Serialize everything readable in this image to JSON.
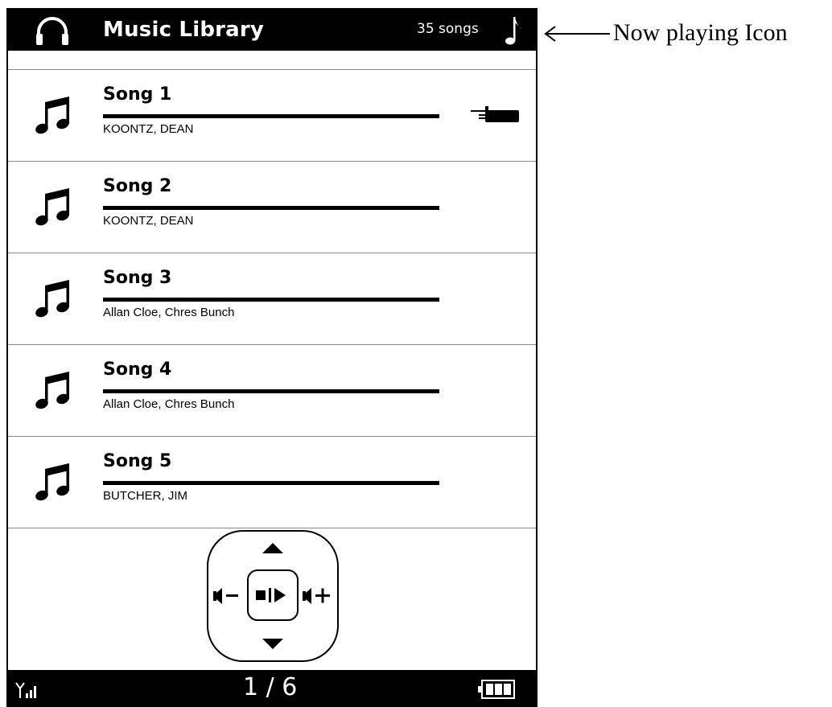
{
  "header": {
    "title": "Music Library",
    "song_count": "35 songs",
    "headphones_icon": "headphones-icon",
    "now_playing_icon": "music-note-icon"
  },
  "songs": [
    {
      "title": "Song 1",
      "artist": "KOONTZ, DEAN",
      "now_playing": true
    },
    {
      "title": "Song 2",
      "artist": "KOONTZ, DEAN",
      "now_playing": false
    },
    {
      "title": "Song 3",
      "artist": "Allan Cloe, Chres Bunch",
      "now_playing": false
    },
    {
      "title": "Song 4",
      "artist": "Allan Cloe, Chres Bunch",
      "now_playing": false
    },
    {
      "title": "Song 5",
      "artist": "BUTCHER, JIM",
      "now_playing": false
    }
  ],
  "controls": {
    "up_icon": "up-arrow-icon",
    "down_icon": "down-arrow-icon",
    "volume_down_icon": "volume-down-icon",
    "volume_up_icon": "volume-up-icon",
    "play_stop_icon": "stop-play-icon"
  },
  "footer": {
    "page": "1 / 6",
    "signal_icon": "signal-icon",
    "battery_icon": "battery-icon"
  },
  "annotation": {
    "label": "Now playing Icon"
  },
  "colors": {
    "bar_background": "#000000",
    "text_on_bar": "#ffffff",
    "divider": "#888888"
  }
}
